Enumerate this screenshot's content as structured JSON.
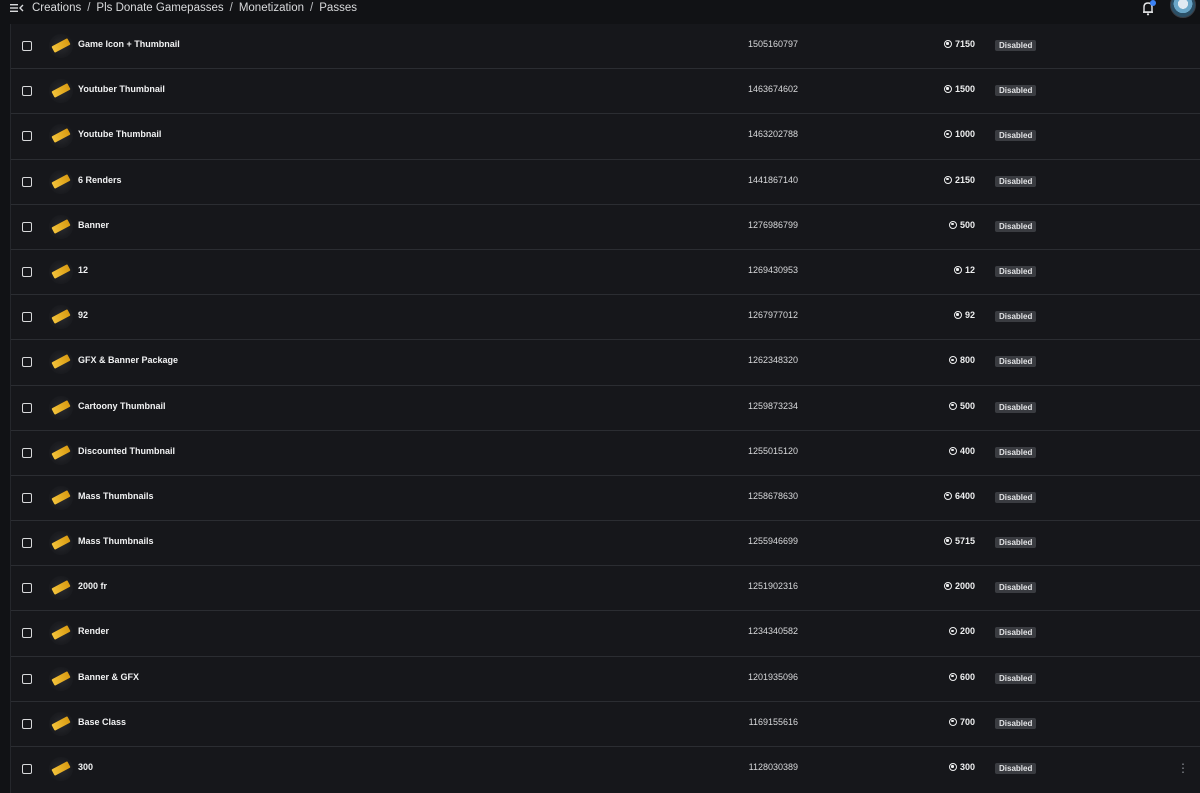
{
  "breadcrumb": [
    "Creations",
    "Pls Donate Gamepasses",
    "Monetization",
    "Passes"
  ],
  "breadcrumb_separator": "/",
  "icons": {
    "menu": "menu-collapse-icon",
    "notifications": "bell-icon",
    "pass": "ticket-icon",
    "currency": "robux-icon",
    "more": "more-vertical-icon"
  },
  "colors": {
    "background": "#111215",
    "table_background": "#16171b",
    "notification_dot": "#3b82f6",
    "status_badge": "#3a3c41",
    "ticket_gold": "#f3c33b"
  },
  "passes": [
    {
      "name": "Game Icon + Thumbnail",
      "id": "1505160797",
      "price": "7150",
      "status": "Disabled"
    },
    {
      "name": "Youtuber Thumbnail",
      "id": "1463674602",
      "price": "1500",
      "status": "Disabled"
    },
    {
      "name": "Youtube Thumbnail",
      "id": "1463202788",
      "price": "1000",
      "status": "Disabled"
    },
    {
      "name": "6 Renders",
      "id": "1441867140",
      "price": "2150",
      "status": "Disabled"
    },
    {
      "name": "Banner",
      "id": "1276986799",
      "price": "500",
      "status": "Disabled"
    },
    {
      "name": "12",
      "id": "1269430953",
      "price": "12",
      "status": "Disabled"
    },
    {
      "name": "92",
      "id": "1267977012",
      "price": "92",
      "status": "Disabled"
    },
    {
      "name": "GFX & Banner Package",
      "id": "1262348320",
      "price": "800",
      "status": "Disabled"
    },
    {
      "name": "Cartoony Thumbnail",
      "id": "1259873234",
      "price": "500",
      "status": "Disabled"
    },
    {
      "name": "Discounted Thumbnail",
      "id": "1255015120",
      "price": "400",
      "status": "Disabled"
    },
    {
      "name": "Mass Thumbnails",
      "id": "1258678630",
      "price": "6400",
      "status": "Disabled"
    },
    {
      "name": "Mass Thumbnails",
      "id": "1255946699",
      "price": "5715",
      "status": "Disabled"
    },
    {
      "name": "2000 fr",
      "id": "1251902316",
      "price": "2000",
      "status": "Disabled"
    },
    {
      "name": "Render",
      "id": "1234340582",
      "price": "200",
      "status": "Disabled"
    },
    {
      "name": "Banner & GFX",
      "id": "1201935096",
      "price": "600",
      "status": "Disabled"
    },
    {
      "name": "Base Class",
      "id": "1169155616",
      "price": "700",
      "status": "Disabled"
    },
    {
      "name": "300",
      "id": "1128030389",
      "price": "300",
      "status": "Disabled"
    }
  ]
}
